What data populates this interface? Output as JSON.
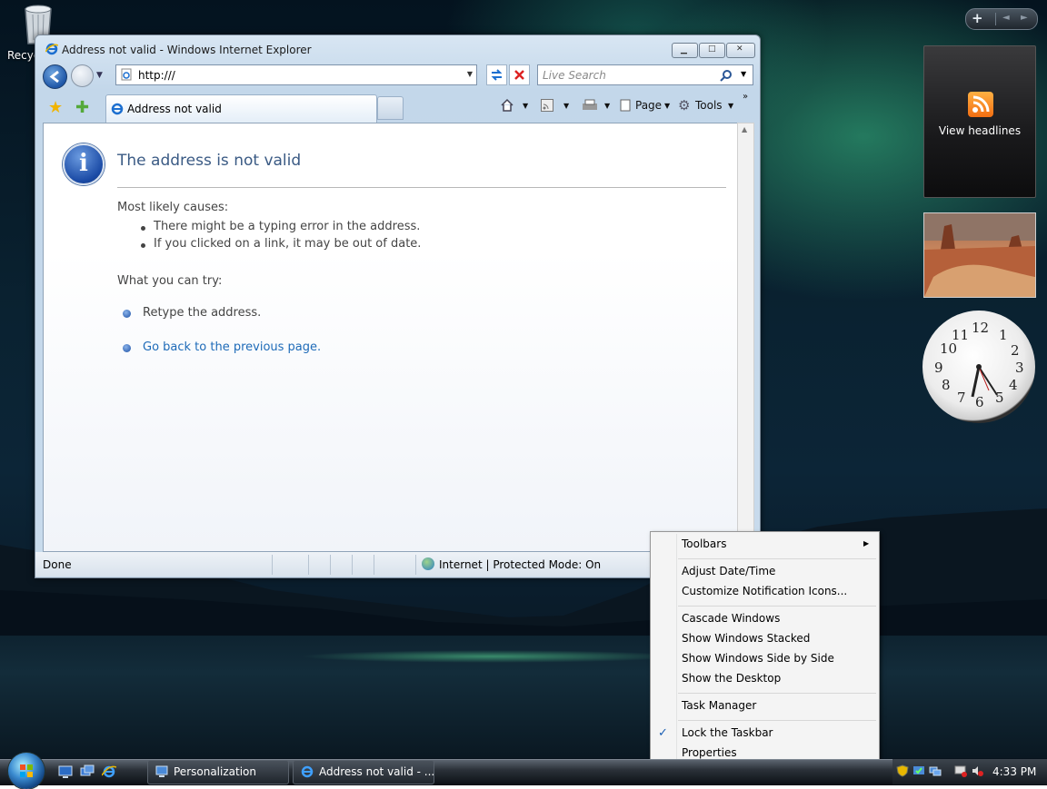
{
  "desktop": {
    "recycle_bin_label": "Recyc",
    "gadget_feed_label": "View headlines",
    "gadget_controls": {
      "add": "+",
      "prev": "◄",
      "next": "►"
    },
    "clock_numbers": [
      "12",
      "1",
      "2",
      "3",
      "4",
      "5",
      "6",
      "7",
      "8",
      "9",
      "10",
      "11"
    ]
  },
  "ie": {
    "window_title": "Address not valid - Windows Internet Explorer",
    "address_value": "http:///",
    "search_placeholder": "Live Search",
    "tab_label": "Address not valid",
    "page_menu": "Page",
    "tools_menu": "Tools",
    "heading": "The address is not valid",
    "causes_heading": "Most likely causes:",
    "causes": [
      "There might be a typing error in the address.",
      "If you clicked on a link, it may be out of date."
    ],
    "try_heading": "What you can try:",
    "try_items": [
      "Retype the address.",
      "Go back to the previous page."
    ],
    "status_text": "Done",
    "zone_text": "Internet | Protected Mode: On"
  },
  "context_menu": {
    "items": [
      "Toolbars",
      "Adjust Date/Time",
      "Customize Notification Icons...",
      "Cascade Windows",
      "Show Windows Stacked",
      "Show Windows Side by Side",
      "Show the Desktop",
      "Task Manager",
      "Lock the Taskbar",
      "Properties"
    ],
    "checked_item": "Lock the Taskbar"
  },
  "taskbar": {
    "buttons": [
      "Personalization",
      "Address not valid - ..."
    ],
    "clock": "4:33 PM"
  },
  "colors": {
    "link": "#1e6bb8",
    "heading": "#3a5a84",
    "accent": "#1a5fb4"
  }
}
